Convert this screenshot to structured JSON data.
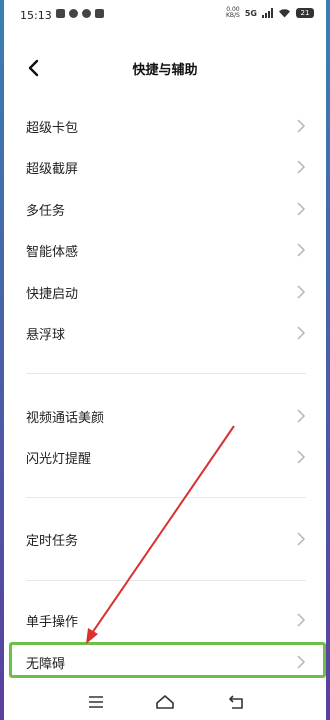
{
  "status_bar": {
    "time": "15:13",
    "net_speed_value": "0.00",
    "net_speed_unit": "KB/S",
    "network": "5G",
    "battery": "21",
    "icons": [
      "image-icon",
      "wechat-icon",
      "message-icon",
      "mail-icon",
      "signal-icon",
      "wifi-icon",
      "battery-icon"
    ]
  },
  "header": {
    "title": "快捷与辅助",
    "back_icon": "chevron-left-icon"
  },
  "groups": [
    {
      "items": [
        "超级卡包",
        "超级截屏",
        "多任务",
        "智能体感",
        "快捷启动",
        "悬浮球"
      ]
    },
    {
      "items": [
        "视频通话美颜",
        "闪光灯提醒"
      ]
    },
    {
      "items": [
        "定时任务"
      ]
    },
    {
      "items": [
        "单手操作",
        "无障碍"
      ]
    }
  ],
  "highlighted_item": "无障碍",
  "annotation_colors": {
    "arrow": "#d93030",
    "highlight_border": "#6cc04a"
  },
  "nav_bar": {
    "buttons": [
      "menu-icon",
      "home-icon",
      "back-icon"
    ]
  }
}
